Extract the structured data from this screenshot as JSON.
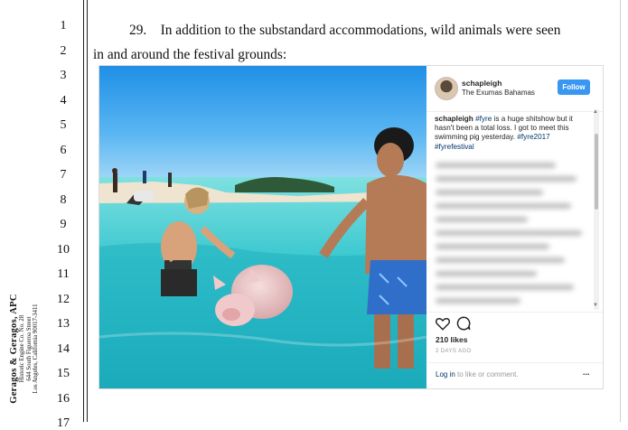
{
  "line_numbers": [
    "1",
    "2",
    "3",
    "4",
    "5",
    "6",
    "7",
    "8",
    "9",
    "10",
    "11",
    "12",
    "13",
    "14",
    "15",
    "16",
    "17"
  ],
  "paragraph": {
    "number": "29.",
    "line1": "In addition to the substandard accommodations, wild animals were seen",
    "line2": "in and around the festival grounds:"
  },
  "firm": {
    "name": "Geragos & Geragos, APC",
    "address_lines": [
      "Historic Engine Co. No. 28",
      "644 South Figueroa Street",
      "Los Angeles, California 90017-3411"
    ]
  },
  "instagram": {
    "username": "schapleigh",
    "location": "The Exumas Bahamas",
    "follow_label": "Follow",
    "caption_user": "schapleigh",
    "caption_text_parts": [
      {
        "t": "#fyre",
        "tag": true
      },
      {
        "t": " is a huge shitshow but it hasn't been a total loss. I got to meet this swimming pig yesterday. ",
        "tag": false
      },
      {
        "t": "#fyre2017",
        "tag": true
      },
      {
        "t": " ",
        "tag": false
      },
      {
        "t": "#fyrefestival",
        "tag": true
      }
    ],
    "likes": "210 likes",
    "time_ago": "2 DAYS AGO",
    "login_link": "Log in",
    "login_text": " to like or comment.",
    "more_label": "...",
    "icons": [
      "heart-icon",
      "comment-icon",
      "more-icon"
    ],
    "colors": {
      "follow_bg": "#3897f0",
      "tag": "#003569"
    }
  }
}
